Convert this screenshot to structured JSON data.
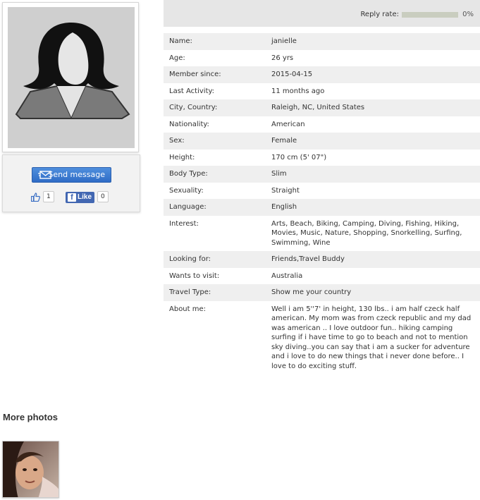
{
  "actions": {
    "send_label": "Send message",
    "like_count": "1",
    "fb_like_label": "Like",
    "fb_count": "0"
  },
  "reply": {
    "label": "Reply rate:",
    "percent_text": "0%",
    "level_fraction": 0
  },
  "profile": {
    "rows": [
      {
        "key": "Name:",
        "value": "janielle"
      },
      {
        "key": "Age:",
        "value": "26 yrs"
      },
      {
        "key": "Member since:",
        "value": "2015-04-15"
      },
      {
        "key": "Last Activity:",
        "value": "11 months ago"
      },
      {
        "key": "City, Country:",
        "value": "Raleigh, NC, United States"
      },
      {
        "key": "Nationality:",
        "value": "American"
      },
      {
        "key": "Sex:",
        "value": "Female"
      },
      {
        "key": "Height:",
        "value": "170 cm (5' 07\")"
      },
      {
        "key": "Body Type:",
        "value": "Slim"
      },
      {
        "key": "Sexuality:",
        "value": "Straight"
      },
      {
        "key": "Language:",
        "value": "English"
      },
      {
        "key": "Interest:",
        "value": "Arts, Beach, Biking, Camping, Diving, Fishing, Hiking, Movies, Music, Nature, Shopping, Snorkelling, Surfing, Swimming, Wine"
      },
      {
        "key": "Looking for:",
        "value": "Friends,Travel Buddy"
      },
      {
        "key": "Wants to visit:",
        "value": "Australia"
      },
      {
        "key": "Travel Type:",
        "value": "Show me your country"
      },
      {
        "key": "About me:",
        "value": "Well i am 5''7' in height, 130 lbs.. i am half czeck half american. My mom was from czeck republic and my dad was american .. I love outdoor fun.. hiking camping surfing if i have time to go to beach and not to mention sky diving..you can say that i am a sucker for adventure and i love to do new things that i never done before.. I love to do exciting stuff."
      }
    ]
  },
  "more_photos": {
    "title": "More photos"
  },
  "icons": {
    "avatar": "female-silhouette-icon",
    "envelope": "envelope-icon",
    "thumbs_up": "thumbs-up-icon",
    "facebook": "facebook-icon"
  },
  "colors": {
    "button": "#2f6cc6",
    "facebook": "#4267b2",
    "row_alt": "#efefef",
    "reply_track": "#c9cdbf"
  }
}
